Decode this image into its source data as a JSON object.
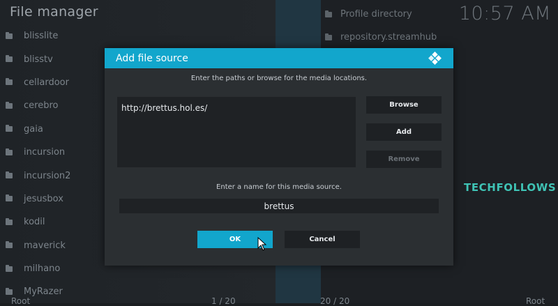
{
  "app_title": "File manager",
  "clock": "10:57 AM",
  "left_list": {
    "items": [
      "blisslite",
      "blisstv",
      "cellardoor",
      "cerebro",
      "gaia",
      "incursion",
      "incursion2",
      "jesusbox",
      "kodil",
      "maverick",
      "milhano",
      "MyRazer"
    ]
  },
  "right_list": {
    "items": [
      "Profile directory",
      "repository.streamhub"
    ]
  },
  "footer": {
    "left_label": "Root",
    "left_count": "1 / 20",
    "right_count": "20 / 20",
    "right_label": "Root"
  },
  "watermark": "TECHFOLLOWS",
  "dialog": {
    "title": "Add file source",
    "paths_instruction": "Enter the paths or browse for the media locations.",
    "paths": [
      "http://brettus.hol.es/"
    ],
    "browse_label": "Browse",
    "add_label": "Add",
    "remove_label": "Remove",
    "name_instruction": "Enter a name for this media source.",
    "name_value": "brettus",
    "ok_label": "OK",
    "cancel_label": "Cancel"
  },
  "colors": {
    "accent": "#12a6cc",
    "watermark": "#3fc3b5",
    "dialog_bg": "#2b2f32"
  },
  "icons": [
    "folder-icon",
    "kodi-logo-icon",
    "mouse-pointer-icon"
  ]
}
